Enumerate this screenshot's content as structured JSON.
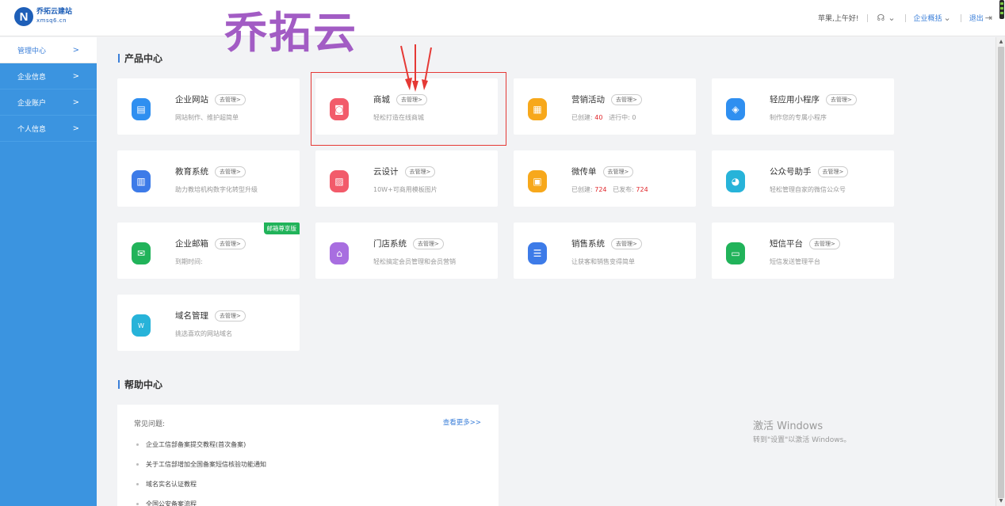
{
  "header": {
    "logo_name": "乔拓云建站",
    "logo_domain": "xmsq6.cn",
    "overlay_title": "乔拓云",
    "greeting": "苹果,上午好!",
    "enterprise_overview": "企业概括",
    "logout": "退出"
  },
  "sidebar": {
    "items": [
      {
        "label": "管理中心"
      },
      {
        "label": "企业信息"
      },
      {
        "label": "企业账户"
      },
      {
        "label": "个人信息"
      }
    ]
  },
  "product_center": {
    "title": "产品中心",
    "manage_label": "去管理>",
    "cards": [
      {
        "name": "企业网站",
        "desc": "网站制作、维护超简单",
        "color": "#2f8ff0"
      },
      {
        "name": "商城",
        "desc": "轻松打造在线商城",
        "color": "#f25b6a"
      },
      {
        "name": "营销活动",
        "desc_prefix": "已创建: ",
        "created": "40",
        "desc_mid": "进行中: 0",
        "color": "#f7a81b"
      },
      {
        "name": "轻应用小程序",
        "desc": "制作您的专属小程序",
        "color": "#2f8ff0"
      },
      {
        "name": "教育系统",
        "desc": "助力教培机构数字化转型升级",
        "color": "#3d7be8"
      },
      {
        "name": "云设计",
        "desc": "10W+可商用模板图片",
        "color": "#f25b6a"
      },
      {
        "name": "微传单",
        "desc_prefix": "已创建: ",
        "created": "724",
        "desc_mid": "已发布: ",
        "published": "724",
        "color": "#f7a81b"
      },
      {
        "name": "公众号助手",
        "desc": "轻松管理自家的微信公众号",
        "color": "#27b3d9"
      },
      {
        "name": "企业邮箱",
        "desc": "到期时间:",
        "badge": "邮箱尊享版",
        "color": "#21b35a"
      },
      {
        "name": "门店系统",
        "desc": "轻松搞定会员管理和会员营销",
        "color": "#a86ee0"
      },
      {
        "name": "销售系统",
        "desc": "让获客和销售变得简单",
        "color": "#3d7be8"
      },
      {
        "name": "短信平台",
        "desc": "短信发送管理平台",
        "color": "#21b35a"
      },
      {
        "name": "域名管理",
        "desc": "挑选喜欢的网站域名",
        "color": "#27b3d9"
      }
    ]
  },
  "help_center": {
    "title": "帮助中心",
    "faq_title": "常见问题:",
    "more": "查看更多>>",
    "items": [
      "企业工信部备案提交教程(首次备案)",
      "关于工信部增加全国备案短信核验功能通知",
      "域名实名认证教程",
      "全国公安备案流程"
    ]
  },
  "watermark": {
    "line1": "激活 Windows",
    "line2": "转到\"设置\"以激活 Windows。"
  }
}
